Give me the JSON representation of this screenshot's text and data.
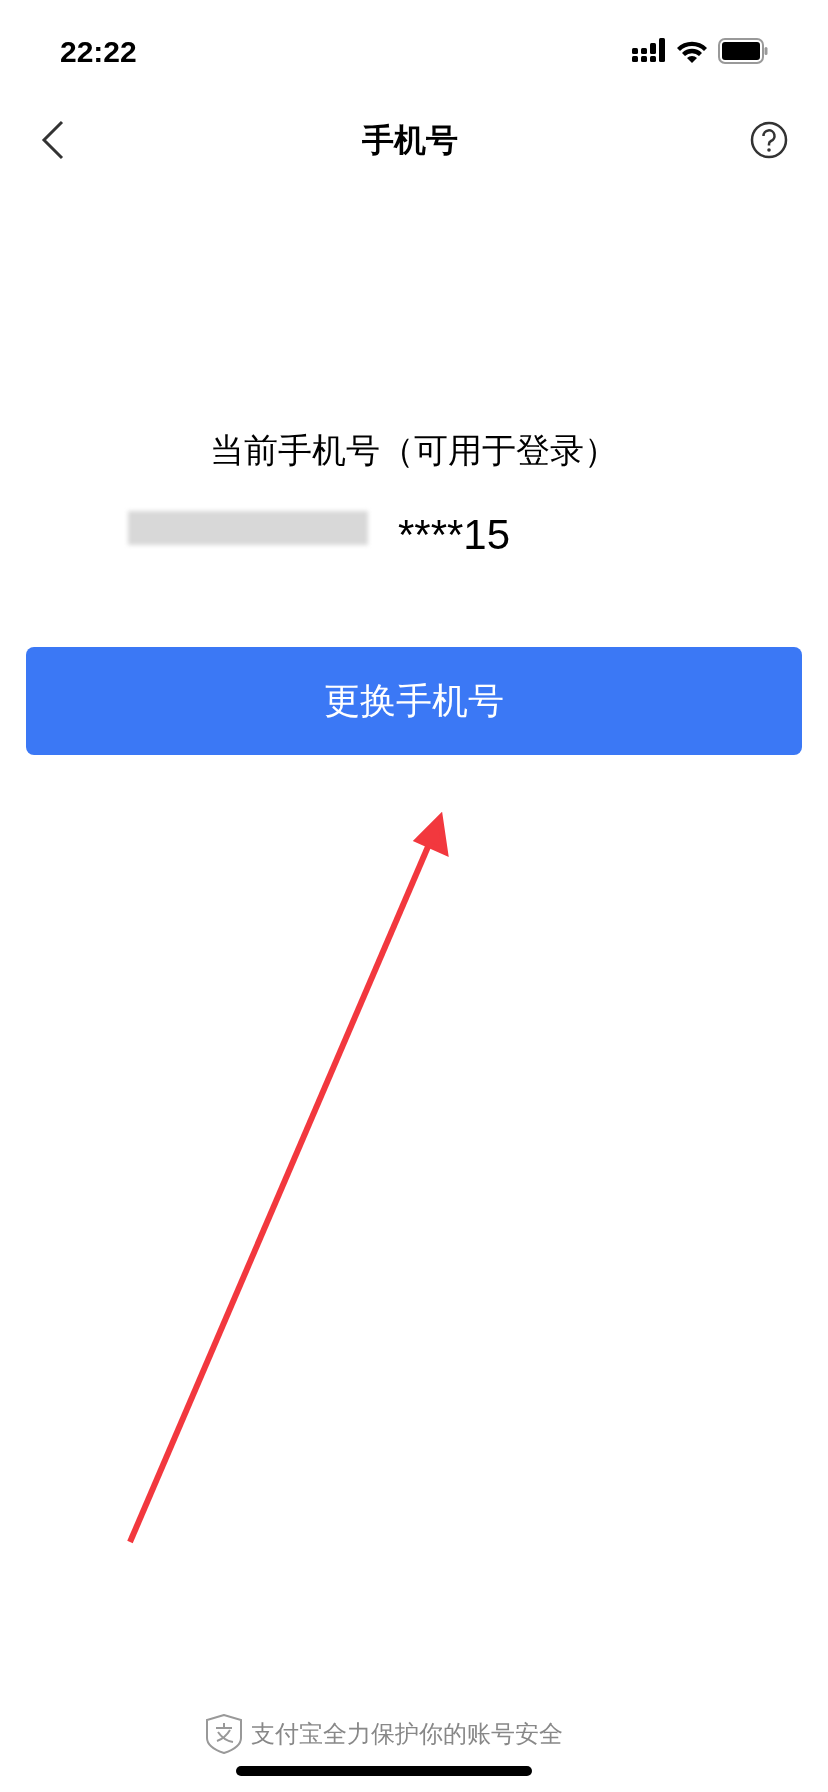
{
  "status_bar": {
    "time": "22:22"
  },
  "nav": {
    "title": "手机号"
  },
  "current": {
    "label": "当前手机号（可用于登录）",
    "number": "****15"
  },
  "button": {
    "label": "更换手机号"
  },
  "footer": {
    "text": "支付宝全力保护你的账号安全"
  }
}
